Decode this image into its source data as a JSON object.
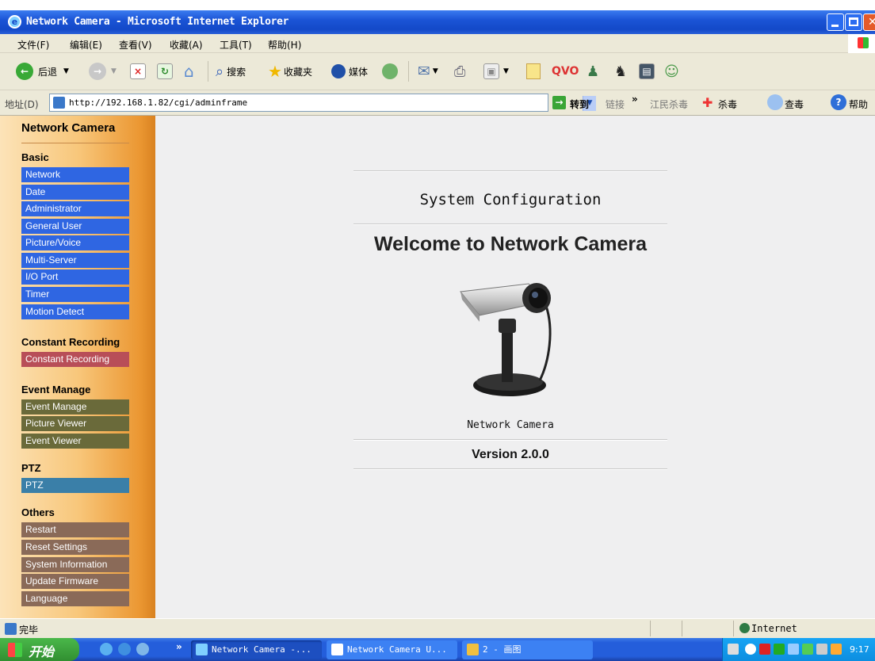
{
  "window": {
    "title": "Network Camera - Microsoft Internet Explorer"
  },
  "menubar": {
    "items": [
      "文件(F)",
      "编辑(E)",
      "查看(V)",
      "收藏(A)",
      "工具(T)",
      "帮助(H)"
    ]
  },
  "toolbar": {
    "back_label": "后退",
    "search_label": "搜索",
    "favorites_label": "收藏夹",
    "media_label": "媒体"
  },
  "addressbar": {
    "label": "地址(D)",
    "url": "http://192.168.1.82/cgi/adminframe",
    "go_label": "转到",
    "links_label": "链接",
    "antivirus_label": "江民杀毒",
    "kill_label": "杀毒",
    "scan_label": "查毒",
    "help_label": "帮助"
  },
  "sidebar": {
    "title": "Network Camera",
    "sections": [
      {
        "heading": "Basic",
        "items": [
          "Network",
          "Date",
          "Administrator",
          "General User",
          "Picture/Voice",
          "Multi-Server",
          "I/O Port",
          "Timer",
          "Motion Detect"
        ]
      },
      {
        "heading": "Constant Recording",
        "items": [
          "Constant Recording"
        ]
      },
      {
        "heading": "Event Manage",
        "items": [
          "Event Manage",
          "Picture Viewer",
          "Event Viewer"
        ]
      },
      {
        "heading": "PTZ",
        "items": [
          "PTZ"
        ]
      },
      {
        "heading": "Others",
        "items": [
          "Restart",
          "Reset Settings",
          "System Information",
          "Update Firmware",
          "Language"
        ]
      }
    ]
  },
  "main": {
    "system_title": "System Configuration",
    "welcome": "Welcome to Network Camera",
    "camera_name": "Network Camera",
    "version": "Version 2.0.0"
  },
  "statusbar": {
    "status": "完毕",
    "zone": "Internet"
  },
  "taskbar": {
    "start_label": "开始",
    "tasks": [
      "Network Camera -...",
      "Network Camera U...",
      "2 - 画图"
    ],
    "clock": "9:17"
  },
  "colors": {
    "nav_basic": "#2f66e2",
    "nav_recording": "#b84e58",
    "nav_event": "#6a6a3a",
    "nav_ptz": "#3a7fa8",
    "nav_others": "#8a6a58"
  }
}
